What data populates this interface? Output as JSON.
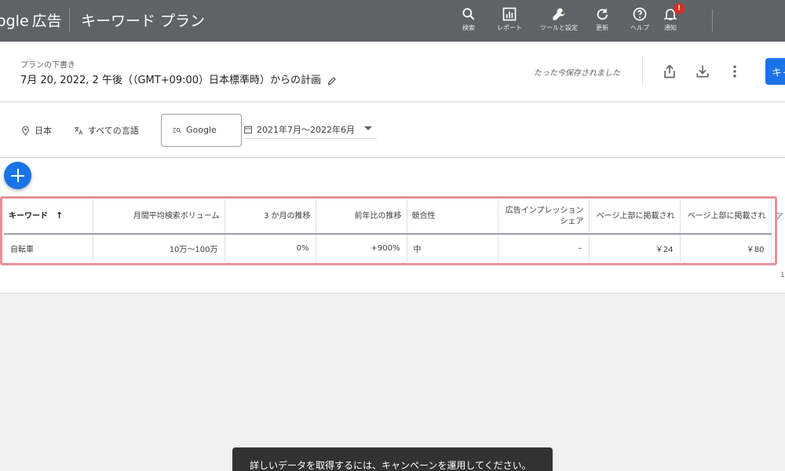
{
  "topbar": {
    "brand_google": "ogle",
    "brand_ads": "広告",
    "title": "キーワード プラン",
    "icons": [
      {
        "name": "search-icon",
        "label": "検索"
      },
      {
        "name": "report-icon",
        "label": "レポート"
      },
      {
        "name": "tools-icon",
        "label": "ツールと設定"
      },
      {
        "name": "refresh-icon",
        "label": "更新"
      },
      {
        "name": "help-icon",
        "label": "ヘルプ"
      },
      {
        "name": "notification-icon",
        "label": "通知",
        "badge": "!"
      }
    ]
  },
  "plan": {
    "draft_label": "プランの下書き",
    "title": "7月 20, 2022, 2 午後（（GMT+09:00）日本標準時）からの計画",
    "saved_status": "たった今保存されました",
    "primary_button_label": "キャ"
  },
  "filters": {
    "location": "日本",
    "language": "すべての言語",
    "network": "Google",
    "date_range": "2021年7月～2022年6月"
  },
  "table": {
    "headers": [
      "キーワード",
      "月間平均検索ボリューム",
      "3 か月の推移",
      "前年比の推移",
      "競合性",
      "広告インプレッション シェア",
      "ページ上部に掲載され",
      "ページ上部に掲載され"
    ],
    "overflow_header": "ア",
    "rows": [
      [
        "自転車",
        "10万～100万",
        "0%",
        "+900%",
        "中",
        "–",
        "￥24",
        "￥80"
      ]
    ]
  },
  "snackbar": {
    "message": "詳しいデータを取得するには、キャンペーンを運用してください。"
  },
  "colors": {
    "topbar": "#5f6368",
    "primary": "#1a73e8",
    "highlight_border": "#e8909a",
    "badge": "#d93025",
    "snackbar": "#323232"
  }
}
